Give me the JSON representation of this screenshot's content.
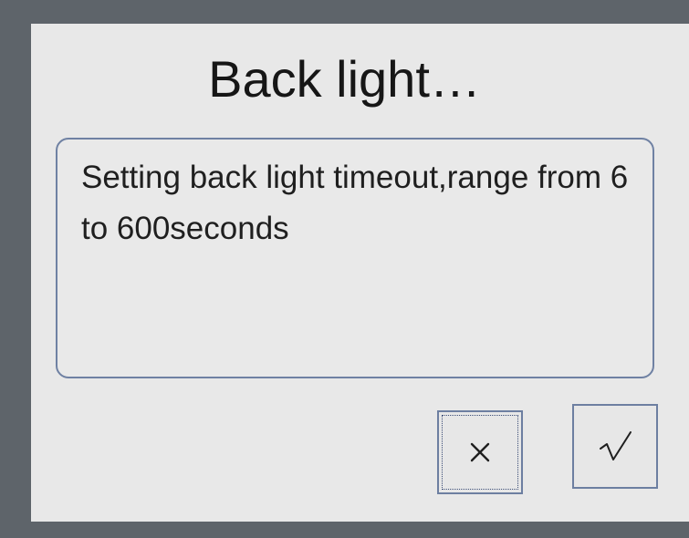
{
  "dialog": {
    "title": "Back light…",
    "message": "Setting back light timeout,range from 6 to 600seconds"
  },
  "buttons": {
    "cancel_icon": "close-icon",
    "confirm_icon": "checkmark-icon"
  },
  "colors": {
    "frame": "#5e646a",
    "panel": "#e8e8e8",
    "border": "#6f81a3",
    "text": "#161616"
  }
}
